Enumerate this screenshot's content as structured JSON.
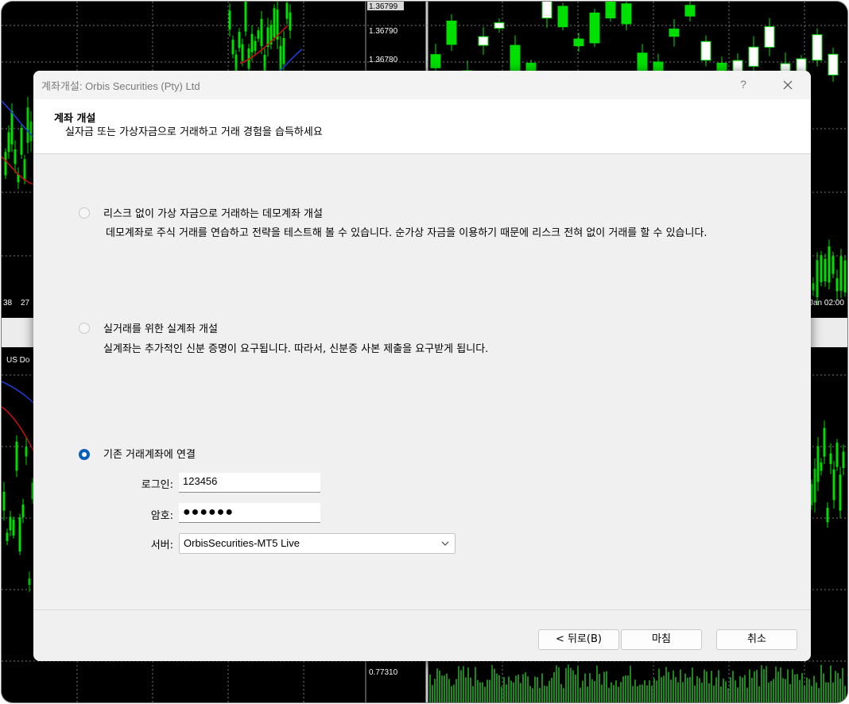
{
  "background_chart": {
    "price_ticks": [
      "1.36799",
      "1.36790",
      "1.36780"
    ],
    "price_tick_lower": "0.77310",
    "time_left_a": "38",
    "time_left_b": "27",
    "time_right": "Jan 02:00",
    "symbol_label": "US Do",
    "colors": {
      "bull": "#00e000",
      "bear_fill": "#ffffff",
      "ma_red": "#d01010",
      "ma_blue": "#2040e0",
      "volume": "#1c8a1c"
    }
  },
  "dialog": {
    "title": "계좌개설: Orbis Securities (Pty) Ltd",
    "help_label": "?",
    "header": {
      "title": "계좌 개설",
      "subtitle": "실자금 또는 가상자금으로 거래하고 거래 경험을 습득하세요"
    },
    "options": [
      {
        "label": "리스크 없이 가상 자금으로 거래하는 데모계좌 개설",
        "description": "데모계좌로 주식 거래를 연습하고 전략을 테스트해 볼 수 있습니다. 순가상 자금을 이용하기 때문에 리스크 전혀 없이 거래를 할 수 있습니다.",
        "selected": false
      },
      {
        "label": "실거래를 위한 실계좌 개설",
        "description": "실계좌는 추가적인 신분 증명이 요구됩니다. 따라서, 신분증 사본 제출을 요구받게 됩니다.",
        "selected": false
      },
      {
        "label": "기존 거래계좌에 연결",
        "selected": true
      }
    ],
    "form": {
      "login_label": "로그인:",
      "login_value": "123456",
      "password_label": "암호:",
      "password_value": "●●●●●●",
      "server_label": "서버:",
      "server_value": "OrbisSecurities-MT5 Live"
    },
    "buttons": {
      "back": "< 뒤로(B)",
      "finish": "마침",
      "cancel": "취소"
    },
    "accent_color": "#0a5fb8"
  }
}
